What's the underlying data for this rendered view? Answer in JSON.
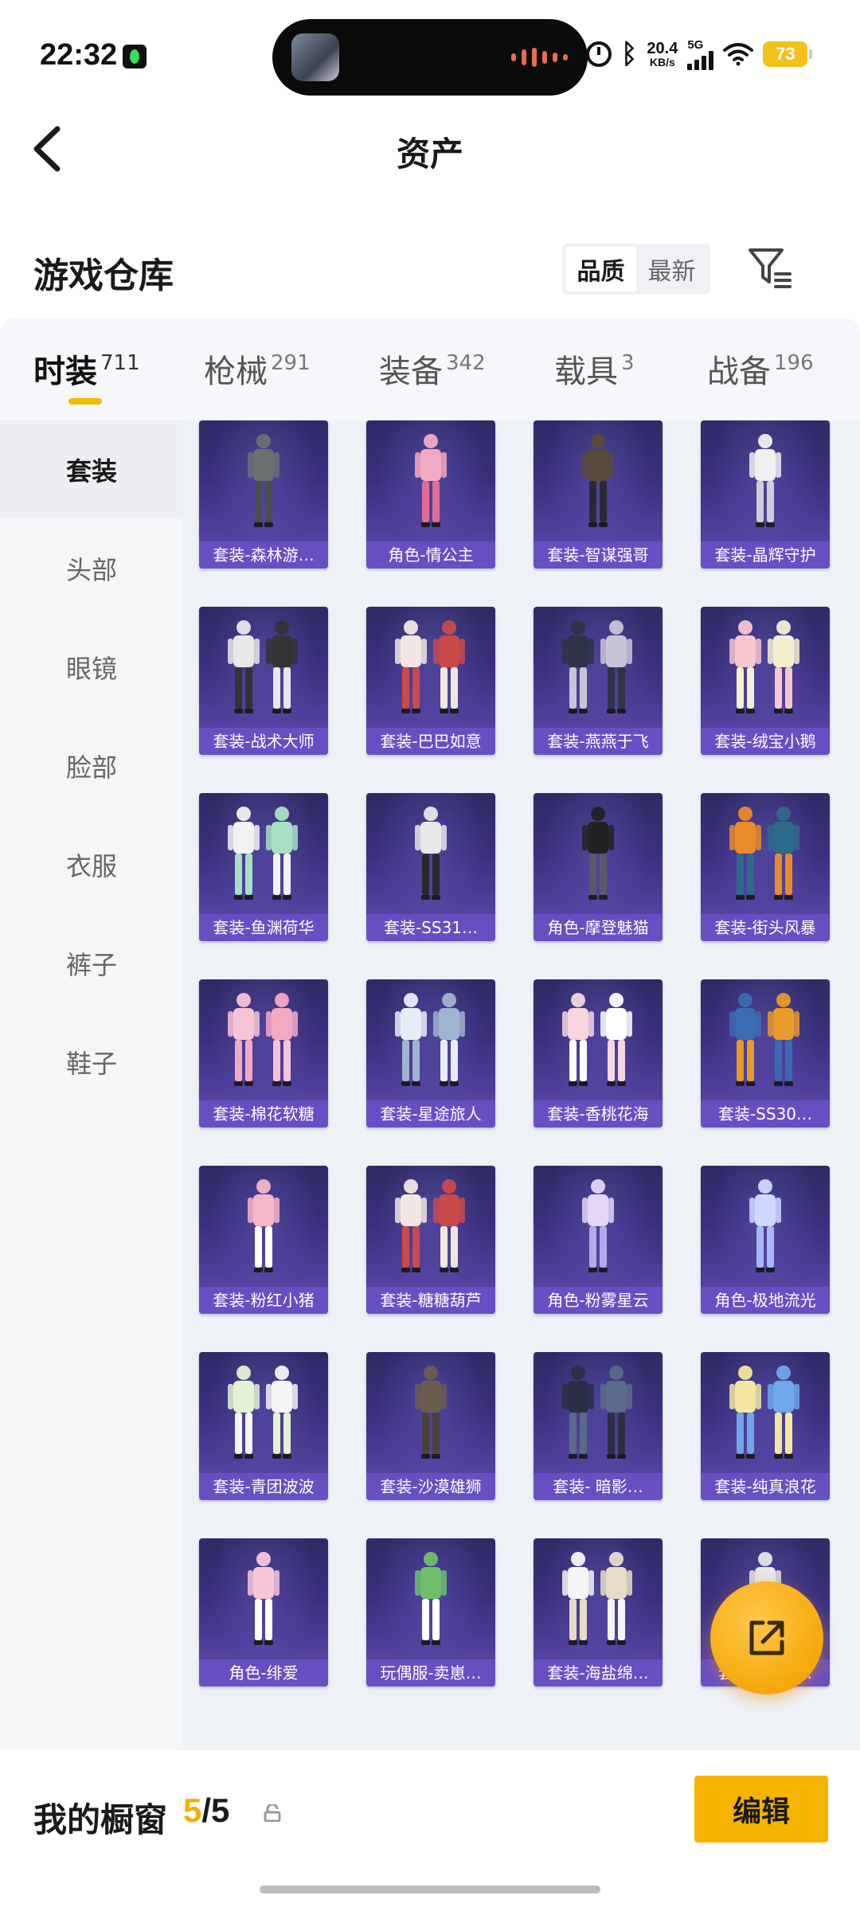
{
  "status_bar": {
    "time": "22:32",
    "net_speed_value": "20.4",
    "net_speed_unit": "KB/s",
    "network_type": "5G",
    "battery_level": "73",
    "battery_color": "#f2c21a"
  },
  "header": {
    "title": "资产",
    "back_icon": "chevron-left-icon"
  },
  "warehouse": {
    "title": "游戏仓库",
    "sort_options": [
      "品质",
      "最新"
    ],
    "sort_selected": "品质",
    "filter_icon": "filter-icon"
  },
  "category_tabs": [
    {
      "label": "时装",
      "count": "711",
      "active": true
    },
    {
      "label": "枪械",
      "count": "291",
      "active": false
    },
    {
      "label": "装备",
      "count": "342",
      "active": false
    },
    {
      "label": "载具",
      "count": "3",
      "active": false
    },
    {
      "label": "战备",
      "count": "196",
      "active": false
    }
  ],
  "side_nav": [
    {
      "label": "套装",
      "active": true
    },
    {
      "label": "头部",
      "active": false
    },
    {
      "label": "眼镜",
      "active": false
    },
    {
      "label": "脸部",
      "active": false
    },
    {
      "label": "衣服",
      "active": false
    },
    {
      "label": "裤子",
      "active": false
    },
    {
      "label": "鞋子",
      "active": false
    }
  ],
  "items": [
    {
      "label": "套装-森林游…"
    },
    {
      "label": "角色-情公主"
    },
    {
      "label": "套装-智谋强哥"
    },
    {
      "label": "套装-晶辉守护"
    },
    {
      "label": "套装-战术大师"
    },
    {
      "label": "套装-巴巴如意"
    },
    {
      "label": "套装-燕燕于飞"
    },
    {
      "label": "套装-绒宝小鹅"
    },
    {
      "label": "套装-鱼渊荷华"
    },
    {
      "label": "套装-SS31…"
    },
    {
      "label": "角色-摩登魅猫"
    },
    {
      "label": "套装-街头风暴"
    },
    {
      "label": "套装-棉花软糖"
    },
    {
      "label": "套装-星途旅人"
    },
    {
      "label": "套装-香桃花海"
    },
    {
      "label": "套装-SS30…"
    },
    {
      "label": "套装-粉红小猪"
    },
    {
      "label": "套装-糖糖葫芦"
    },
    {
      "label": "角色-粉雾星云"
    },
    {
      "label": "角色-极地流光"
    },
    {
      "label": "套装-青团波波"
    },
    {
      "label": "套装-沙漠雄狮"
    },
    {
      "label": "套装- 暗影…"
    },
    {
      "label": "套装-纯真浪花"
    },
    {
      "label": "角色-绯爱"
    },
    {
      "label": "玩偶服-卖崽…"
    },
    {
      "label": "套装-海盐绵…"
    },
    {
      "label": "套装-SS28…"
    }
  ],
  "bottom_bar": {
    "showcase_title": "我的橱窗",
    "showcase_current": "5",
    "showcase_separator": "/",
    "showcase_total": "5",
    "edit_label": "编辑",
    "accent_color": "#f5b400"
  },
  "fab": {
    "icon": "share-icon"
  }
}
